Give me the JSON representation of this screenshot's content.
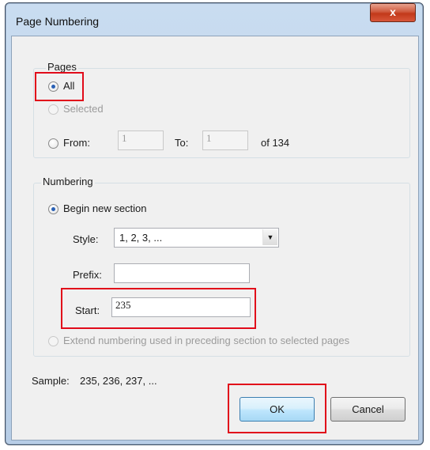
{
  "window": {
    "title": "Page Numbering",
    "close_glyph": "x"
  },
  "pages": {
    "legend": "Pages",
    "all_label": "All",
    "selected_label": "Selected",
    "from_label": "From:",
    "from_value": "1",
    "to_label": "To:",
    "to_value": "1",
    "of_text": "of 134"
  },
  "numbering": {
    "legend": "Numbering",
    "begin_new_label": "Begin new section",
    "style_label": "Style:",
    "style_value": "1, 2, 3, ...",
    "prefix_label": "Prefix:",
    "prefix_value": "",
    "start_label": "Start:",
    "start_value": "235",
    "extend_label": "Extend numbering used in preceding section to selected pages"
  },
  "sample": {
    "label": "Sample:",
    "value": "235, 236, 237, ..."
  },
  "buttons": {
    "ok": "OK",
    "cancel": "Cancel"
  },
  "colors": {
    "highlight": "#e10b1a",
    "radio_dot": "#2a61b5",
    "close": "#c2391a"
  },
  "icons": {
    "close": "close-icon",
    "dropdown": "chevron-down-icon"
  }
}
